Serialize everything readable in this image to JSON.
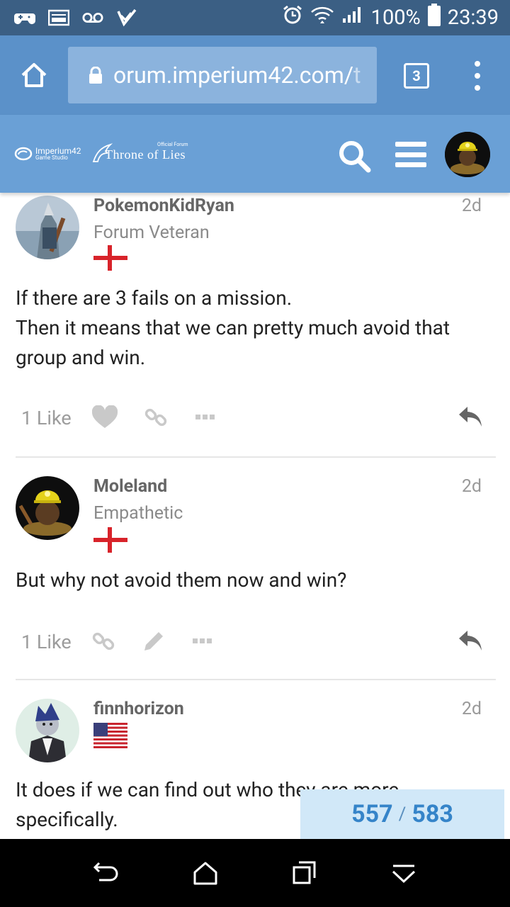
{
  "status_bar": {
    "battery": "100%",
    "time": "23:39",
    "left_icons": [
      "game-controller-icon",
      "image-icon",
      "voicemail-icon",
      "checkmark-icon"
    ],
    "right_icons": [
      "alarm-icon",
      "wifi-icon",
      "signal-icon",
      "battery-icon"
    ]
  },
  "browser": {
    "url_main": "orum.imperium42.com/",
    "url_dim": "t",
    "tab_count": "3"
  },
  "forum_header": {
    "studio_logo_line1": "Imperium42",
    "studio_logo_line2": "Game Studio",
    "forum_logo_small": "Official Forum",
    "forum_logo_big": "Throne of Lies"
  },
  "posts": [
    {
      "username": "PokemonKidRyan",
      "user_title": "Forum Veteran",
      "date": "2d",
      "flag": "england",
      "body_line1": "If there are 3 fails on a mission.",
      "body_line2": "Then it means that we can pretty much avoid that group and win.",
      "like_count": "1 Like"
    },
    {
      "username": "Moleland",
      "user_title": "Empathetic",
      "date": "2d",
      "flag": "england",
      "body_line1": "But why not avoid them now and win?",
      "like_count": "1 Like"
    },
    {
      "username": "finnhorizon",
      "user_title": "",
      "date": "2d",
      "flag": "usa",
      "body_line1": "It does if we can find out who they are more specifically."
    }
  ],
  "progress": {
    "current": "557",
    "separator": "/",
    "total": "583",
    "accent": "#3584c9"
  },
  "colors": {
    "status_bar": "#3b5f84",
    "browser_bar": "#5b91c9",
    "forum_header": "#6aa0d6",
    "flag_red": "#d8232a"
  }
}
